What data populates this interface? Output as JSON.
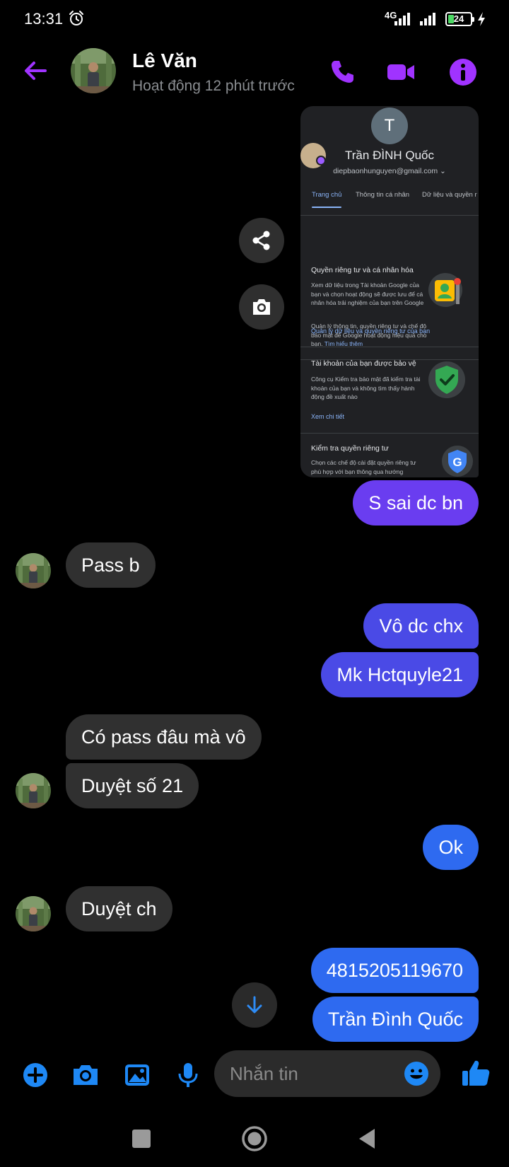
{
  "status_bar": {
    "time": "13:31",
    "network": "4G",
    "battery": "24",
    "battery_level": 0.24
  },
  "header": {
    "name": "Lê Văn",
    "status": "Hoạt động 12 phút trước"
  },
  "shared_image": {
    "initial": "T",
    "account_name": "Trần ĐÌNH Quốc",
    "email": "diepbaonhunguyen@gmail.com",
    "tabs": [
      "Trang chủ",
      "Thông tin cá nhân",
      "Dữ liệu và quyền r"
    ],
    "intro_text": "Quản lý thông tin, quyền riêng tư và chế độ bảo mật để Google hoạt động hiệu quả cho bạn.",
    "intro_link": "Tìm hiểu thêm",
    "sections": [
      {
        "title": "Quyền riêng tư và cá nhân hóa",
        "body": "Xem dữ liệu trong Tài khoản Google của bạn và chọn hoạt động sẽ được lưu để cá nhân hóa trải nghiệm của bạn trên Google",
        "link": "Quản lý dữ liệu và quyền riêng tư của bạn"
      },
      {
        "title": "Tài khoản của bạn được bảo vệ",
        "body": "Công cụ Kiểm tra bảo mật đã kiểm tra tài khoản của bạn và không tìm thấy hành động đề xuất nào",
        "link": "Xem chi tiết"
      },
      {
        "title": "Kiểm tra quyền riêng tư",
        "body": "Chọn các chế độ cài đặt quyền riêng tư phù hợp với bạn thông qua hướng"
      }
    ]
  },
  "messages": [
    {
      "text": "S sai dc bn",
      "side": "out"
    },
    {
      "text": "Pass b",
      "side": "in"
    },
    {
      "text": "Vô dc chx",
      "side": "out"
    },
    {
      "text": "Mk Hctquyle21",
      "side": "out"
    },
    {
      "text": "Có pass đâu mà vô",
      "side": "in"
    },
    {
      "text": "Duyệt số 21",
      "side": "in"
    },
    {
      "text": "Ok",
      "side": "out"
    },
    {
      "text": "Duyệt ch",
      "side": "in"
    },
    {
      "text": "4815205119670",
      "side": "out"
    },
    {
      "text": "Trần Đình Quốc",
      "side": "out"
    }
  ],
  "composer": {
    "placeholder": "Nhắn tin"
  },
  "colors": {
    "accent": "#a033ff",
    "bubble_purple": "#6a3df0",
    "bubble_indigo": "#4a4ae6",
    "bubble_blue": "#2e6af0",
    "bubble_incoming": "#303030",
    "composer_icon": "#1e88f5"
  }
}
